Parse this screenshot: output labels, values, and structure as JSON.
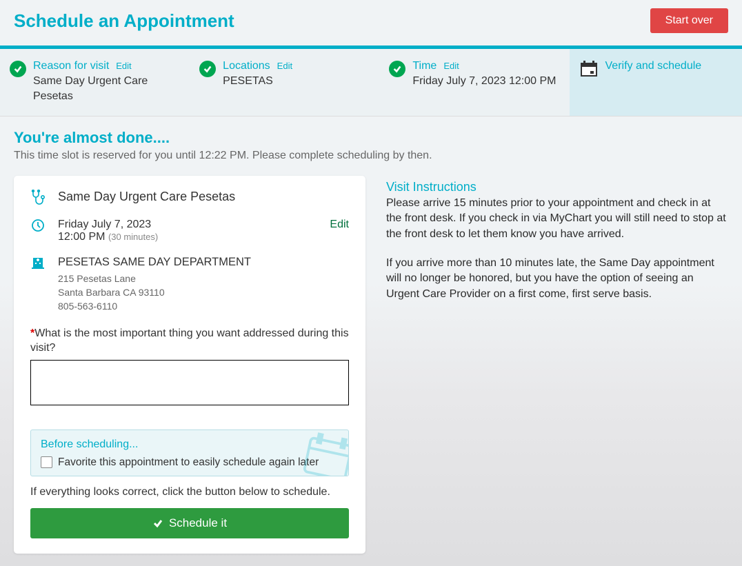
{
  "header": {
    "title": "Schedule an Appointment",
    "start_over": "Start over"
  },
  "steps": {
    "reason": {
      "title": "Reason for visit",
      "edit": "Edit",
      "value": "Same Day Urgent Care Pesetas"
    },
    "locations": {
      "title": "Locations",
      "edit": "Edit",
      "value": "PESETAS"
    },
    "time": {
      "title": "Time",
      "edit": "Edit",
      "value": "Friday July 7, 2023 12:00 PM"
    },
    "verify": {
      "title": "Verify and schedule"
    }
  },
  "almost_done": "You're almost done....",
  "reserved": "This time slot is reserved for you until 12:22 PM. Please complete scheduling by then.",
  "card": {
    "visit_name": "Same Day Urgent Care Pesetas",
    "date": "Friday July 7, 2023",
    "time": "12:00 PM",
    "duration": "(30 minutes)",
    "edit": "Edit",
    "dept": "PESETAS SAME DAY DEPARTMENT",
    "addr1": "215 Pesetas Lane",
    "addr2": "Santa Barbara CA 93110",
    "phone": "805-563-6110",
    "question": "What is the most important thing you want addressed during this visit?",
    "before_title": "Before scheduling...",
    "favorite_label": "Favorite this appointment to easily schedule again later",
    "confirm": "If everything looks correct, click the button below to schedule.",
    "schedule_btn": "Schedule it"
  },
  "instructions": {
    "title": "Visit Instructions",
    "p1": "Please arrive 15 minutes prior to your appointment and check in at the front desk. If you check in via MyChart you will still need to stop at the front desk to let them know you have arrived.",
    "p2": "If you arrive more than 10 minutes late, the Same Day appointment will no longer be honored, but you have the option of seeing an Urgent Care Provider on a first come, first serve basis."
  }
}
